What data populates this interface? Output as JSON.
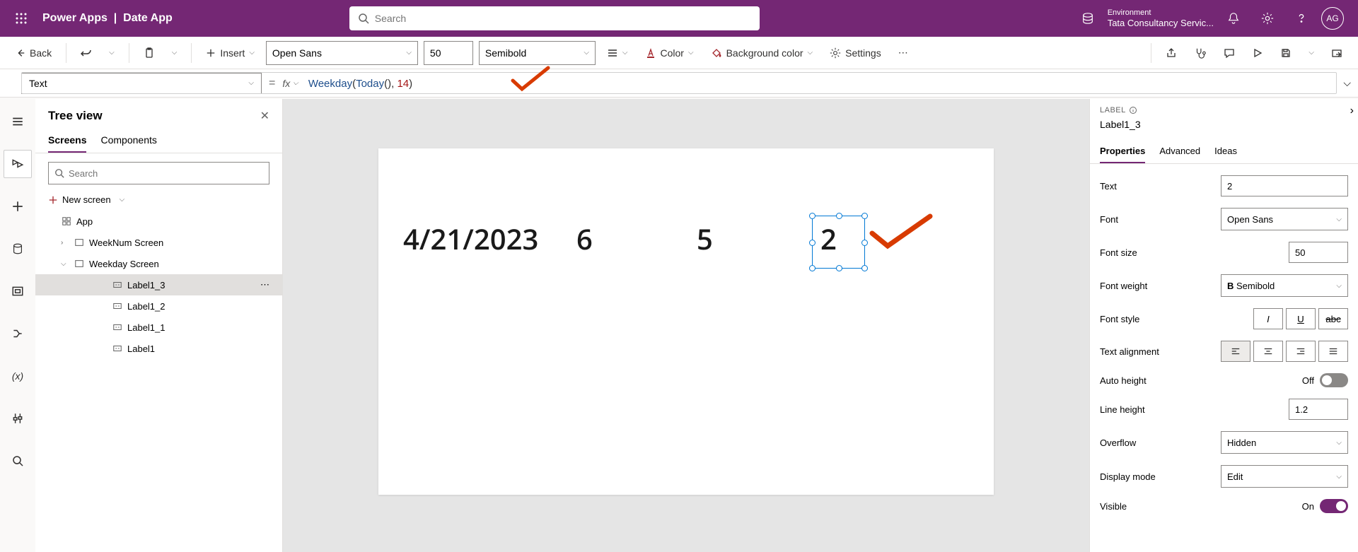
{
  "header": {
    "product": "Power Apps",
    "separator": "|",
    "app_name": "Date App",
    "search_placeholder": "Search",
    "env_label": "Environment",
    "env_name": "Tata Consultancy Servic...",
    "avatar_initials": "AG"
  },
  "cmd": {
    "back": "Back",
    "insert": "Insert",
    "font_name": "Open Sans",
    "font_size": "50",
    "font_weight": "Semibold",
    "color": "Color",
    "bgcolor": "Background color",
    "settings": "Settings"
  },
  "fx": {
    "prop_label": "Text",
    "eq": "=",
    "fx": "fx",
    "formula_fn": "Weekday",
    "formula_inner_fn": "Today",
    "formula_arg": "14"
  },
  "tree": {
    "title": "Tree view",
    "tab_screens": "Screens",
    "tab_components": "Components",
    "search_placeholder": "Search",
    "new_screen": "New screen",
    "app": "App",
    "screen1": "WeekNum Screen",
    "screen2": "Weekday Screen",
    "l13": "Label1_3",
    "l12": "Label1_2",
    "l11": "Label1_1",
    "l1": "Label1"
  },
  "canvas": {
    "date": "4/21/2023",
    "v6": "6",
    "v5": "5",
    "v2": "2"
  },
  "props": {
    "type_label": "LABEL",
    "control_name": "Label1_3",
    "tab_properties": "Properties",
    "tab_advanced": "Advanced",
    "tab_ideas": "Ideas",
    "text_label": "Text",
    "text_value": "2",
    "font_label": "Font",
    "font_value": "Open Sans",
    "fontsize_label": "Font size",
    "fontsize_value": "50",
    "fontweight_label": "Font weight",
    "fontweight_value": "Semibold",
    "fontstyle_label": "Font style",
    "align_label": "Text alignment",
    "autoheight_label": "Auto height",
    "autoheight_value": "Off",
    "lineheight_label": "Line height",
    "lineheight_value": "1.2",
    "overflow_label": "Overflow",
    "overflow_value": "Hidden",
    "displaymode_label": "Display mode",
    "displaymode_value": "Edit",
    "visible_label": "Visible",
    "visible_value": "On"
  }
}
